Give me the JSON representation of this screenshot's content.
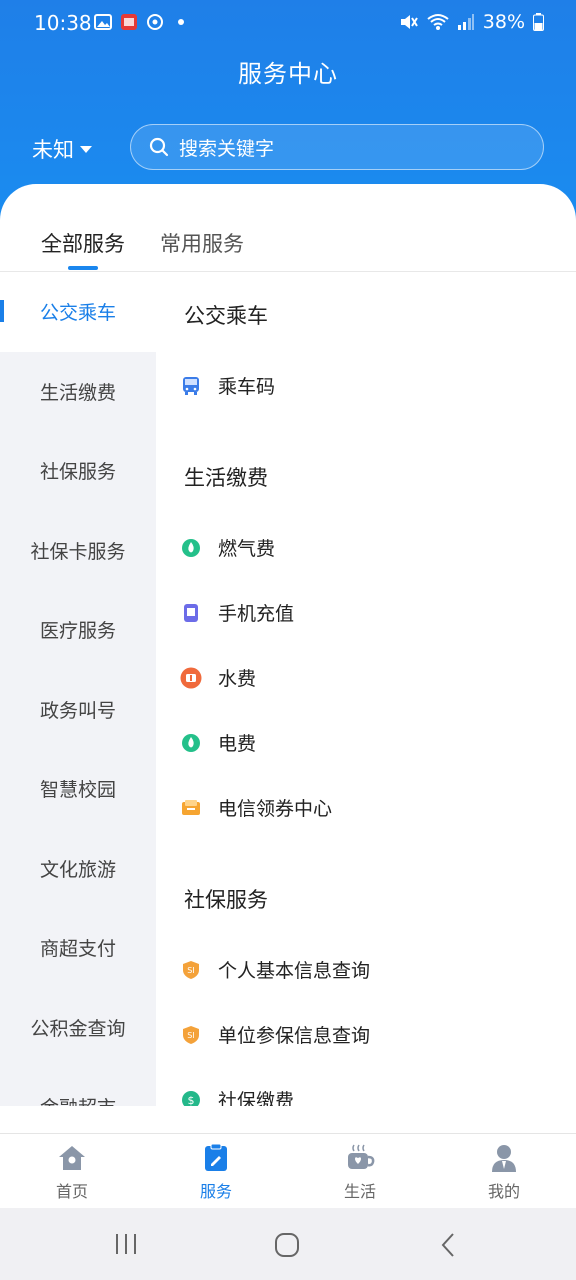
{
  "status_bar": {
    "time": "10:38",
    "battery": "38%"
  },
  "header": {
    "title": "服务中心",
    "region": "未知",
    "search_placeholder": "搜索关键字"
  },
  "tabs": [
    {
      "label": "全部服务",
      "active": true
    },
    {
      "label": "常用服务",
      "active": false
    }
  ],
  "categories": [
    {
      "label": "公交乘车",
      "active": true
    },
    {
      "label": "生活缴费"
    },
    {
      "label": "社保服务"
    },
    {
      "label": "社保卡服务"
    },
    {
      "label": "医疗服务"
    },
    {
      "label": "政务叫号"
    },
    {
      "label": "智慧校园"
    },
    {
      "label": "文化旅游"
    },
    {
      "label": "商超支付"
    },
    {
      "label": "公积金查询"
    },
    {
      "label": "金融超市"
    }
  ],
  "sections": [
    {
      "title": "公交乘车",
      "items": [
        {
          "label": "乘车码",
          "icon": "bus-icon"
        }
      ]
    },
    {
      "title": "生活缴费",
      "items": [
        {
          "label": "燃气费",
          "icon": "gas-icon"
        },
        {
          "label": "手机充值",
          "icon": "phone-recharge-icon"
        },
        {
          "label": "水费",
          "icon": "water-icon"
        },
        {
          "label": "电费",
          "icon": "electricity-icon"
        },
        {
          "label": "电信领券中心",
          "icon": "coupon-icon"
        }
      ]
    },
    {
      "title": "社保服务",
      "items": [
        {
          "label": "个人基本信息查询",
          "icon": "social-security-icon"
        },
        {
          "label": "单位参保信息查询",
          "icon": "social-security-icon"
        },
        {
          "label": "社保缴费",
          "icon": "payment-icon"
        }
      ]
    }
  ],
  "bottom_nav": [
    {
      "label": "首页",
      "icon": "home-icon"
    },
    {
      "label": "服务",
      "icon": "service-icon",
      "active": true
    },
    {
      "label": "生活",
      "icon": "coffee-icon"
    },
    {
      "label": "我的",
      "icon": "profile-icon"
    }
  ],
  "colors": {
    "brand_blue": "#1a86ee",
    "category_bg": "#f2f3f7"
  }
}
